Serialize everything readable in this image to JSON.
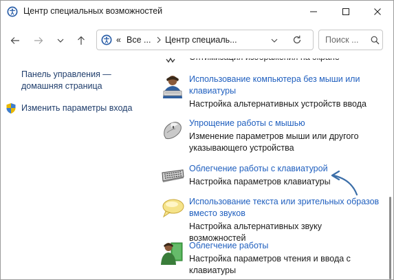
{
  "window": {
    "title": "Центр специальных возможностей",
    "controls": {
      "minimize": "minimize-icon",
      "maximize": "maximize-icon",
      "close": "close-icon"
    }
  },
  "nav": {
    "back_icon": "arrow-left-icon",
    "forward_icon": "arrow-right-icon",
    "recent_icon": "chevron-down-icon",
    "up_icon": "arrow-up-icon",
    "address": {
      "prefix": "«",
      "segment1": "Все ...",
      "segment2": "Центр специаль..."
    },
    "search": {
      "placeholder": "Поиск ..."
    }
  },
  "left_pane": {
    "home_link": "Панель управления — домашняя страница",
    "change_login_link": "Изменить параметры входа"
  },
  "partial_item": {
    "text": "Оптимизация изображения на экране"
  },
  "items": [
    {
      "icon": "person-keyboard-icon",
      "title": "Использование компьютера без мыши или клавиатуры",
      "desc": "Настройка альтернативных устройств ввода"
    },
    {
      "icon": "mouse-icon",
      "title": "Упрощение работы с мышью",
      "desc": "Изменение параметров мыши или другого указывающего устройства"
    },
    {
      "icon": "keyboard-icon",
      "title": "Облегчение работы с клавиатурой",
      "desc": "Настройка параметров клавиатуры"
    },
    {
      "icon": "speech-bubble-icon",
      "title": "Использование текста или зрительных образов вместо звуков",
      "desc": "Настройка альтернативных звуку возможностей"
    },
    {
      "icon": "person-book-icon",
      "title": "Облегчение работы",
      "desc": "Настройка параметров чтения и ввода с клавиатуры"
    }
  ],
  "colors": {
    "link": "#1f5fbf",
    "left_link": "#1f3d6b",
    "annotation_arrow": "#3b6ea8"
  }
}
